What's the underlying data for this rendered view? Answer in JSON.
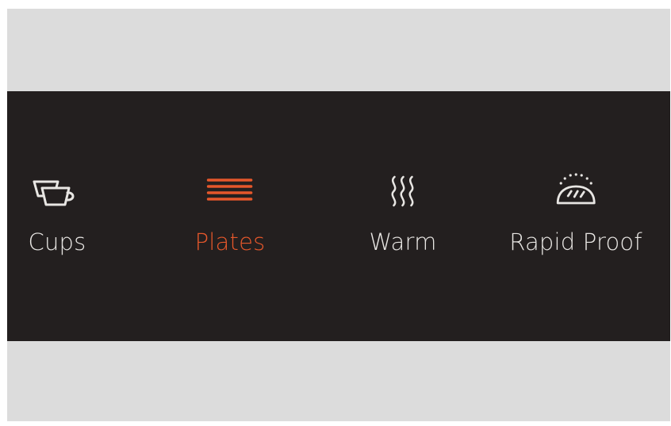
{
  "control_panel": {
    "modes": [
      {
        "label": "Cups",
        "icon": "cups-icon",
        "active": false
      },
      {
        "label": "Plates",
        "icon": "plates-icon",
        "active": true
      },
      {
        "label": "Warm",
        "icon": "warm-icon",
        "active": false
      },
      {
        "label": "Rapid Proof",
        "icon": "rapid-proof-icon",
        "active": false
      }
    ],
    "colors": {
      "panel_background": "#231f1f",
      "label_default": "#e8e6e3",
      "accent_active": "#e5572b",
      "outer_background": "#dcdcdc"
    }
  }
}
